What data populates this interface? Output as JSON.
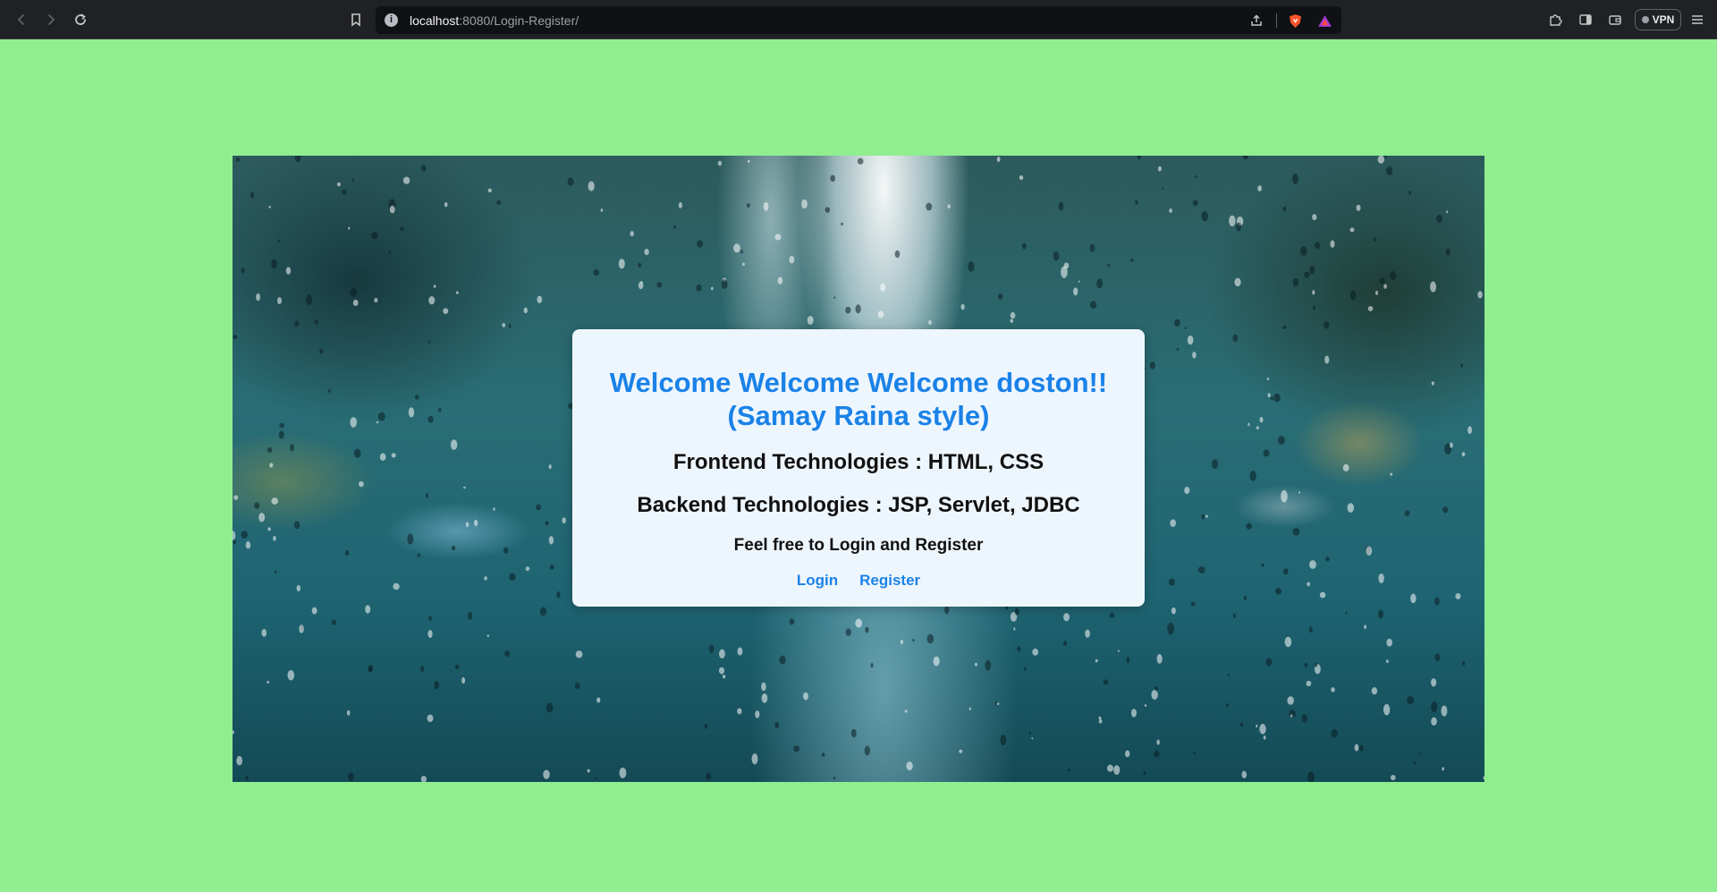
{
  "browser": {
    "url_host": "localhost",
    "url_path": ":8080/Login-Register/",
    "vpn_label": "VPN",
    "icons": [
      "back-arrow-icon",
      "forward-arrow-icon",
      "reload-icon",
      "bookmark-icon",
      "site-info-icon",
      "share-icon",
      "brave-shields-icon",
      "brave-rewards-icon",
      "extensions-icon",
      "sidebar-icon",
      "wallet-icon",
      "menu-icon"
    ]
  },
  "page": {
    "background_color": "#90ee90",
    "card": {
      "title": "Welcome Welcome Welcome doston!! (Samay Raina style)",
      "frontend": "Frontend Technologies : HTML, CSS",
      "backend": "Backend Technologies : JSP, Servlet, JDBC",
      "invite": "Feel free to Login and Register",
      "login_label": "Login",
      "register_label": "Register"
    },
    "accent_color": "#1a82e8"
  }
}
